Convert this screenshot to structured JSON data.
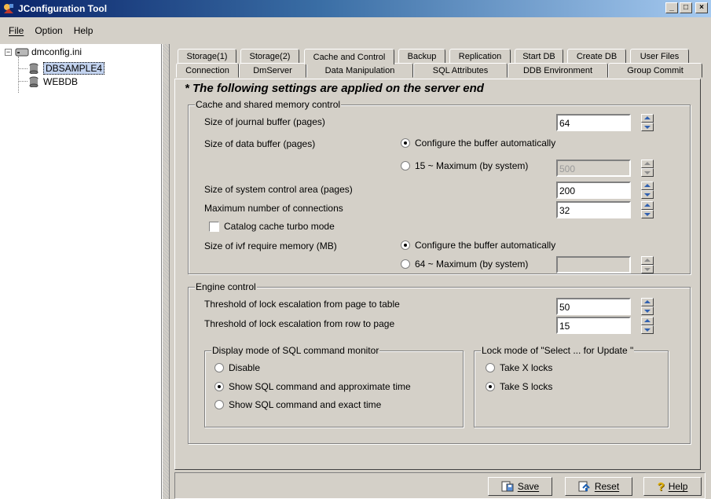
{
  "window": {
    "title": "JConfiguration Tool"
  },
  "menu": {
    "file": "File",
    "option": "Option",
    "help": "Help"
  },
  "tree": {
    "root": "dmconfig.ini",
    "items": [
      "DBSAMPLE4",
      "WEBDB"
    ]
  },
  "tabs": {
    "row1": [
      "Storage(1)",
      "Storage(2)",
      "Cache and Control",
      "Backup",
      "Replication",
      "Start DB",
      "Create DB",
      "User Files"
    ],
    "row2": [
      "Connection",
      "DmServer",
      "Data Manipulation",
      "SQL Attributes",
      "DDB Environment",
      "Group Commit"
    ],
    "active": "Cache and Control"
  },
  "content": {
    "notice": "* The following settings are applied on the server end",
    "cache_group": {
      "title": "Cache and shared memory control",
      "journal_label": "Size of journal buffer (pages)",
      "journal_value": "64",
      "data_buffer_label": "Size of data buffer (pages)",
      "data_auto_label": "Configure the buffer automatically",
      "data_manual_label": "15 ~ Maximum (by system)",
      "data_manual_value": "500",
      "sys_area_label": "Size of system control area (pages)",
      "sys_area_value": "200",
      "max_conn_label": "Maximum number of connections",
      "max_conn_value": "32",
      "catalog_turbo_label": "Catalog cache turbo mode",
      "ivf_label": "Size of ivf require memory (MB)",
      "ivf_auto_label": "Configure the buffer automatically",
      "ivf_manual_label": "64 ~ Maximum (by system)",
      "ivf_manual_value": ""
    },
    "engine_group": {
      "title": "Engine control",
      "lock_page_label": "Threshold of lock escalation from page to table",
      "lock_page_value": "50",
      "lock_row_label": "Threshold of lock escalation from row to page",
      "lock_row_value": "15",
      "display_mode": {
        "title": "Display mode of SQL command monitor",
        "options": [
          "Disable",
          "Show SQL command and approximate time",
          "Show SQL command and exact time"
        ],
        "selected": 1
      },
      "lock_mode": {
        "title": "Lock mode of \"Select ... for Update \"",
        "options": [
          "Take X locks",
          "Take S locks"
        ],
        "selected": 1
      }
    }
  },
  "buttons": {
    "save": "Save",
    "reset": "Reset",
    "help": "Help"
  },
  "colors": {
    "titlebar_start": "#0a246a",
    "titlebar_end": "#a6caf0",
    "selection": "#c3d3ef"
  }
}
